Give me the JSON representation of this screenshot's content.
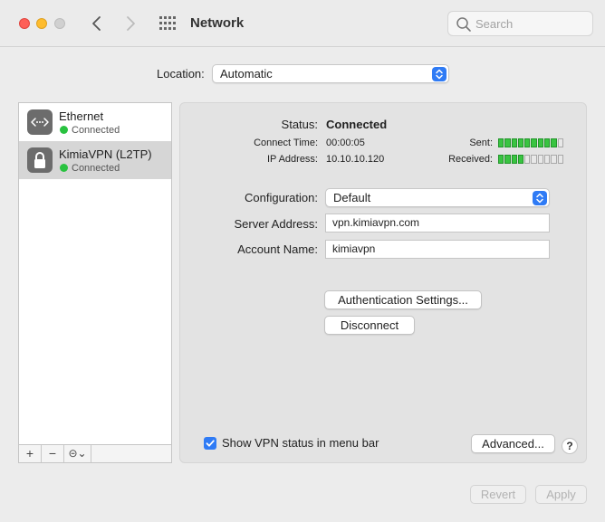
{
  "window": {
    "title": "Network"
  },
  "search": {
    "placeholder": "Search"
  },
  "location": {
    "label": "Location:",
    "value": "Automatic"
  },
  "services": [
    {
      "name": "Ethernet",
      "status": "Connected",
      "icon": "ethernet-icon",
      "selected": false
    },
    {
      "name": "KimiaVPN (L2TP)",
      "status": "Connected",
      "icon": "lock-icon",
      "selected": true
    }
  ],
  "sidebar_toolbar": {
    "add": "+",
    "remove": "−",
    "actions": "⊝⌄"
  },
  "detail": {
    "status_label": "Status:",
    "status_value": "Connected",
    "connect_time_label": "Connect Time:",
    "connect_time_value": "00:00:05",
    "ip_label": "IP Address:",
    "ip_value": "10.10.10.120",
    "sent_label": "Sent:",
    "received_label": "Received:",
    "sent_level": 0.9,
    "received_level": 0.4,
    "configuration_label": "Configuration:",
    "configuration_value": "Default",
    "server_label": "Server Address:",
    "server_value": "vpn.kimiavpn.com",
    "account_label": "Account Name:",
    "account_value": "kimiavpn",
    "auth_button": "Authentication Settings...",
    "disconnect_button": "Disconnect",
    "show_vpn_label": "Show VPN status in menu bar",
    "show_vpn_checked": true,
    "advanced_button": "Advanced...",
    "help_button": "?"
  },
  "footer": {
    "revert": "Revert",
    "apply": "Apply"
  },
  "colors": {
    "accent": "#2f7bf5",
    "connected": "#29c240",
    "meter_on": "#39c441"
  }
}
